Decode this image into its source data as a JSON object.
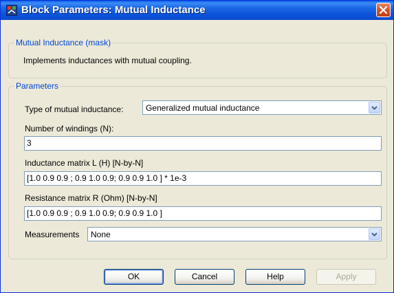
{
  "window": {
    "title": "Block Parameters: Mutual Inductance",
    "icon": "simulink-block-icon",
    "close_icon": "close-icon"
  },
  "mask": {
    "legend": "Mutual Inductance (mask)",
    "description": "Implements inductances with mutual coupling."
  },
  "parameters": {
    "legend": "Parameters",
    "type_label": "Type of mutual inductance:",
    "type_value": "Generalized mutual inductance",
    "windings_label": "Number of windings (N):",
    "windings_value": "3",
    "inductance_label": "Inductance matrix L (H) [N-by-N]",
    "inductance_value": "[1.0 0.9  0.9 ;  0.9 1.0  0.9;  0.9 0.9 1.0 ] * 1e-3",
    "resistance_label": "Resistance matrix R (Ohm) [N-by-N]",
    "resistance_value": "[1.0 0.9  0.9 ;  0.9 1.0  0.9;  0.9 0.9 1.0 ]",
    "measurements_label": "Measurements",
    "measurements_value": "None"
  },
  "buttons": {
    "ok": "OK",
    "cancel": "Cancel",
    "help": "Help",
    "apply": "Apply"
  },
  "colors": {
    "titlebar": "#0a54da",
    "legend_text": "#0046d5",
    "dialog_bg": "#ece9d8",
    "close_button": "#d9542a"
  }
}
